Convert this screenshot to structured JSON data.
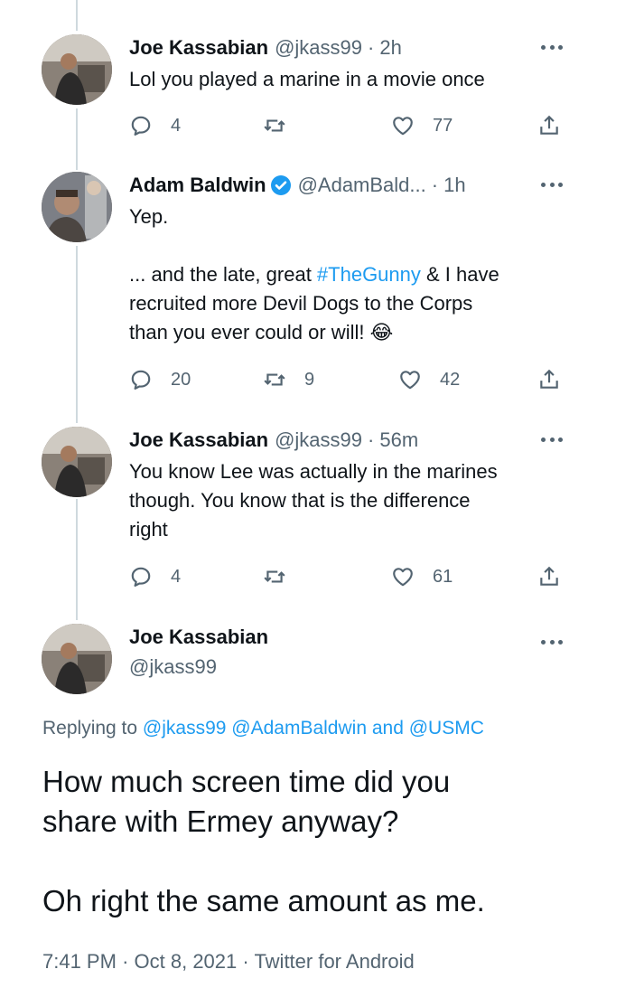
{
  "tweets": [
    {
      "name": "Joe Kassabian",
      "handle": "@jkass99",
      "time": "2h",
      "lines": [
        "Lol you played a marine in a movie once"
      ],
      "replies": "4",
      "retweets": "",
      "likes": "77"
    },
    {
      "name": "Adam Baldwin",
      "handle": "@AdamBald...",
      "time": "1h",
      "verified": true,
      "text_line1": "Yep.",
      "text_line3_pre": "... and the late, great ",
      "hashtag": "#TheGunny",
      "text_line3_post": " & I have",
      "text_line4": "recruited more Devil Dogs to the Corps",
      "text_line5": "than you ever could or will! ",
      "emoji": "😂",
      "replies": "20",
      "retweets": "9",
      "likes": "42"
    },
    {
      "name": "Joe Kassabian",
      "handle": "@jkass99",
      "time": "56m",
      "lines": [
        "You know Lee was actually in the marines",
        "though. You know that is the difference",
        "right"
      ],
      "replies": "4",
      "retweets": "",
      "likes": "61"
    }
  ],
  "main_tweet": {
    "name": "Joe Kassabian",
    "handle": "@jkass99",
    "replying_prefix": "Replying to ",
    "mention1": "@jkass99",
    "mention2": "@AdamBaldwin",
    "and": " and ",
    "mention3": "@USMC",
    "line1": "How much screen time did you",
    "line2": "share with Ermey anyway?",
    "line3": "Oh right the same amount as me.",
    "time": "7:41 PM",
    "date": "Oct 8, 2021",
    "source": "Twitter for Android"
  },
  "colors": {
    "accent": "#1d9bf0",
    "secondary_text": "#536471",
    "thread_line": "#cfd9de"
  }
}
